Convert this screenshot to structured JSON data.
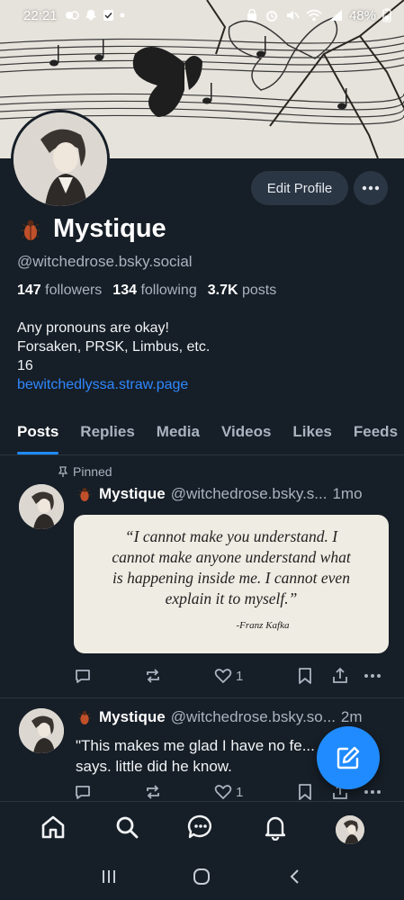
{
  "status_bar": {
    "time": "22:21",
    "battery": "48%"
  },
  "profile": {
    "name": "Mystique",
    "handle": "@witchedrose.bsky.social",
    "followers_count": "147",
    "followers_label": "followers",
    "following_count": "134",
    "following_label": "following",
    "posts_count": "3.7K",
    "posts_label": "posts",
    "bio_lines": [
      "Any pronouns are okay!",
      "Forsaken, PRSK, Limbus, etc.",
      "16"
    ],
    "link": "bewitchedlyssa.straw.page",
    "edit_label": "Edit Profile"
  },
  "tabs": [
    {
      "label": "Posts",
      "active": true
    },
    {
      "label": "Replies",
      "active": false
    },
    {
      "label": "Media",
      "active": false
    },
    {
      "label": "Videos",
      "active": false
    },
    {
      "label": "Likes",
      "active": false
    },
    {
      "label": "Feeds",
      "active": false
    }
  ],
  "posts": [
    {
      "pinned_label": "Pinned",
      "author": "Mystique",
      "handle": "@witchedrose.bsky.s...",
      "time": "1mo",
      "quote_lines": [
        "“I cannot make you understand. I",
        "cannot make anyone understand what",
        "is happening inside me. I cannot even",
        "explain it to myself.”"
      ],
      "quote_author": "-Franz Kafka",
      "like_count": "1"
    },
    {
      "author": "Mystique",
      "handle": "@witchedrose.bsky.so...",
      "time": "2m",
      "text": "\"This makes me glad I have no fe... dexter says. little did he know.",
      "like_count": "1"
    }
  ],
  "colors": {
    "background": "#161e27",
    "accent": "#208bfe",
    "link": "#2f88ff",
    "muted": "#a9b4c0"
  },
  "icons": [
    "beetle-icon",
    "pin-icon",
    "reply-icon",
    "repost-icon",
    "heart-icon",
    "bookmark-icon",
    "share-icon",
    "more-icon",
    "compose-icon",
    "home-icon",
    "search-icon",
    "chat-icon",
    "bell-icon"
  ]
}
